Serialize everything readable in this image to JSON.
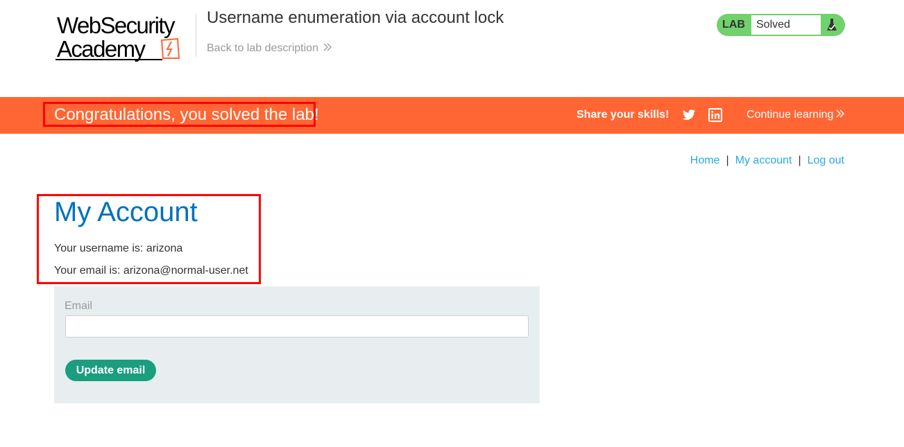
{
  "header": {
    "logo": {
      "line1": "WebSecurity",
      "line2": "Academy"
    },
    "lab_title": "Username enumeration via account lock",
    "back_link": "Back to lab description",
    "lab_status": {
      "tag": "LAB",
      "status": "Solved"
    }
  },
  "banner": {
    "message": "Congratulations, you solved the lab!",
    "share_label": "Share your skills!",
    "continue_label": "Continue learning"
  },
  "nav": {
    "home": "Home",
    "separator": "|",
    "my_account": "My account",
    "log_out": "Log out"
  },
  "account": {
    "title": "My Account",
    "username_line": "Your username is: arizona",
    "email_line": "Your email is: arizona@normal-user.net"
  },
  "form": {
    "email_label": "Email",
    "email_value": "",
    "button_label": "Update email"
  },
  "colors": {
    "banner": "#ff6633",
    "lab_solved": "#70d16d",
    "link": "#29a9e0",
    "title": "#0071bc",
    "button": "#1a9e7e",
    "highlight_box": "#ff0000"
  },
  "icons": {
    "logo_mark": "lightning-bolt-icon",
    "lab_status": "flask-icon",
    "share_twitter": "twitter-icon",
    "share_linkedin": "linkedin-icon",
    "chevrons": "double-chevron-right-icon"
  }
}
